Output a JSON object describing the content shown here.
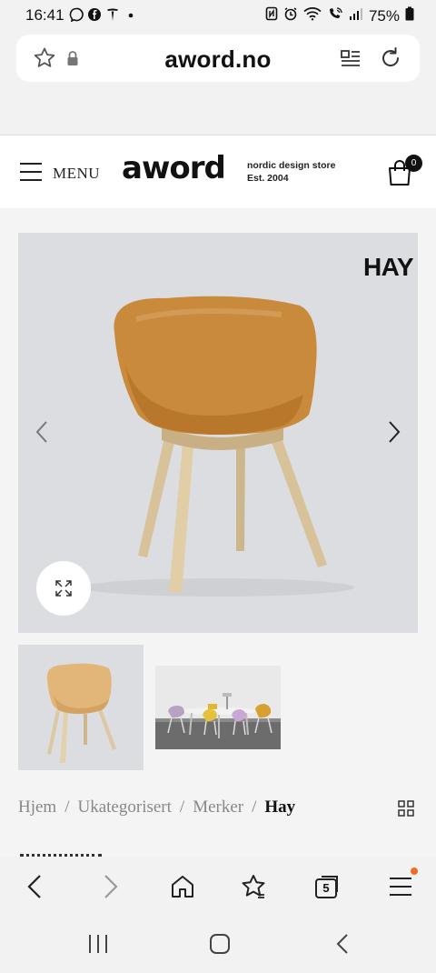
{
  "status_bar": {
    "time": "16:41",
    "battery": "75%"
  },
  "address_bar": {
    "url": "aword.no"
  },
  "site_header": {
    "menu_label": "MENU",
    "logo": "aword",
    "tagline_line1": "nordic design store",
    "tagline_line2": "Est. 2004",
    "cart_count": "0"
  },
  "product_gallery": {
    "brand_label": "HAY",
    "thumbnail_count": 2
  },
  "breadcrumb": {
    "items": [
      "Hjem",
      "Ukategorisert",
      "Merker"
    ],
    "current": "Hay",
    "separator": "/"
  },
  "browser_nav": {
    "tab_count": "5"
  },
  "colors": {
    "page_background": "#f4f4f4",
    "hero_background": "#dcdde0",
    "chair_leather": "#c98a3c",
    "chair_wood": "#d8c29a",
    "notification_dot": "#f06a2b"
  }
}
